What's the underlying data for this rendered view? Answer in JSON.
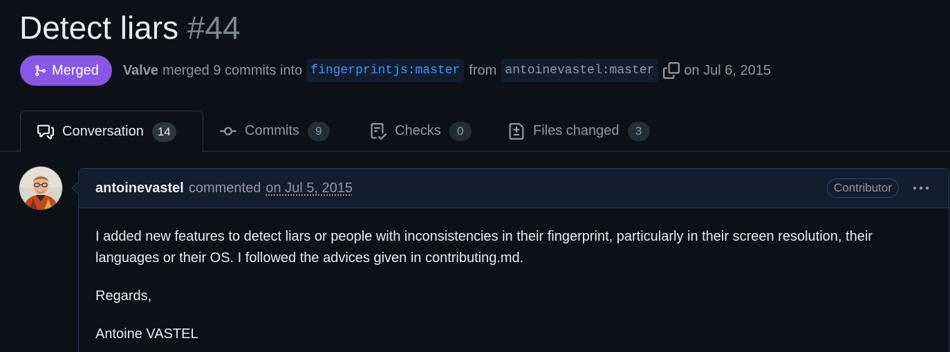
{
  "pr": {
    "title": "Detect liars",
    "number": "#44",
    "state": "Merged",
    "author": "Valve",
    "action_text": "merged 9 commits into",
    "base_branch": "fingerprintjs:master",
    "from_text": "from",
    "head_branch": "antoinevastel:master",
    "date_text": "on Jul 6, 2015"
  },
  "tabs": [
    {
      "label": "Conversation",
      "count": "14",
      "icon": "comment-discussion-icon",
      "selected": true
    },
    {
      "label": "Commits",
      "count": "9",
      "icon": "git-commit-icon",
      "selected": false
    },
    {
      "label": "Checks",
      "count": "0",
      "icon": "checklist-icon",
      "selected": false
    },
    {
      "label": "Files changed",
      "count": "3",
      "icon": "file-diff-icon",
      "selected": false
    }
  ],
  "comment": {
    "author": "antoinevastel",
    "action": "commented",
    "time": "on Jul 5, 2015",
    "role": "Contributor",
    "body": [
      "I added new features to detect liars or people with inconsistencies in their fingerprint, particularly in their screen resolution, their languages or their OS. I followed the advices given in contributing.md.",
      "Regards,",
      "Antoine VASTEL"
    ]
  },
  "colors": {
    "background": "#0d1117",
    "merged": "#8957e5",
    "link": "#4493f8",
    "muted": "#9198a1",
    "comment_header": "#121d2f"
  }
}
